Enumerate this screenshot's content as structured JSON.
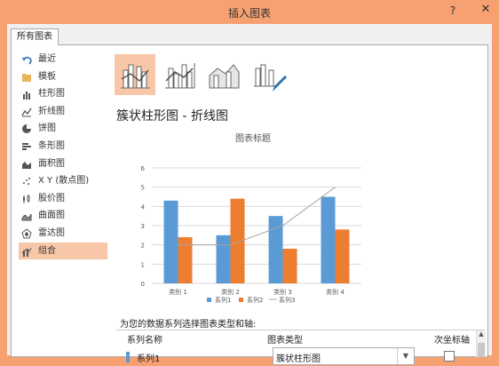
{
  "window": {
    "title": "插入图表",
    "help_icon": "?",
    "close_icon": "✕"
  },
  "tab": {
    "label": "所有图表"
  },
  "sidebar": {
    "items": [
      {
        "label": "最近",
        "icon": "undo-icon"
      },
      {
        "label": "模板",
        "icon": "folder-icon"
      },
      {
        "label": "柱形图",
        "icon": "column-chart-icon"
      },
      {
        "label": "折线图",
        "icon": "line-chart-icon"
      },
      {
        "label": "饼图",
        "icon": "pie-chart-icon"
      },
      {
        "label": "条形图",
        "icon": "bar-chart-icon"
      },
      {
        "label": "面积图",
        "icon": "area-chart-icon"
      },
      {
        "label": "X Y (散点图)",
        "icon": "scatter-chart-icon"
      },
      {
        "label": "股价图",
        "icon": "stock-chart-icon"
      },
      {
        "label": "曲面图",
        "icon": "surface-chart-icon"
      },
      {
        "label": "雷达图",
        "icon": "radar-chart-icon"
      },
      {
        "label": "组合",
        "icon": "combo-chart-icon",
        "selected": true
      }
    ]
  },
  "combo_types": [
    {
      "name": "clustered-column-line-icon",
      "selected": true
    },
    {
      "name": "clustered-column-line-secondary-icon"
    },
    {
      "name": "stacked-area-clustered-column-icon"
    },
    {
      "name": "custom-combination-icon"
    }
  ],
  "main": {
    "chart_title": "簇状柱形图 - 折线图"
  },
  "chart_data": {
    "type": "bar",
    "title": "图表标题",
    "categories": [
      "类别 1",
      "类别 2",
      "类别 3",
      "类别 4"
    ],
    "ylim": [
      0,
      6
    ],
    "yticks": [
      "0",
      "1",
      "2",
      "3",
      "4",
      "5",
      "6"
    ],
    "series": [
      {
        "name": "系列1",
        "kind": "bar",
        "color": "#5b9bd5",
        "values": [
          4.3,
          2.5,
          3.5,
          4.5
        ]
      },
      {
        "name": "系列2",
        "kind": "bar",
        "color": "#ed7d31",
        "values": [
          2.4,
          4.4,
          1.8,
          2.8
        ]
      },
      {
        "name": "系列3",
        "kind": "line",
        "color": "#a5a5a5",
        "values": [
          2,
          2,
          3,
          5
        ]
      }
    ],
    "legend": "bottom"
  },
  "assign": {
    "prompt": "为您的数据系列选择图表类型和轴:",
    "headers": {
      "series": "系列名称",
      "type": "图表类型",
      "axis": "次坐标轴"
    },
    "rows": [
      {
        "series": "系列1",
        "type": "簇状柱形图",
        "secondary": false
      }
    ]
  }
}
